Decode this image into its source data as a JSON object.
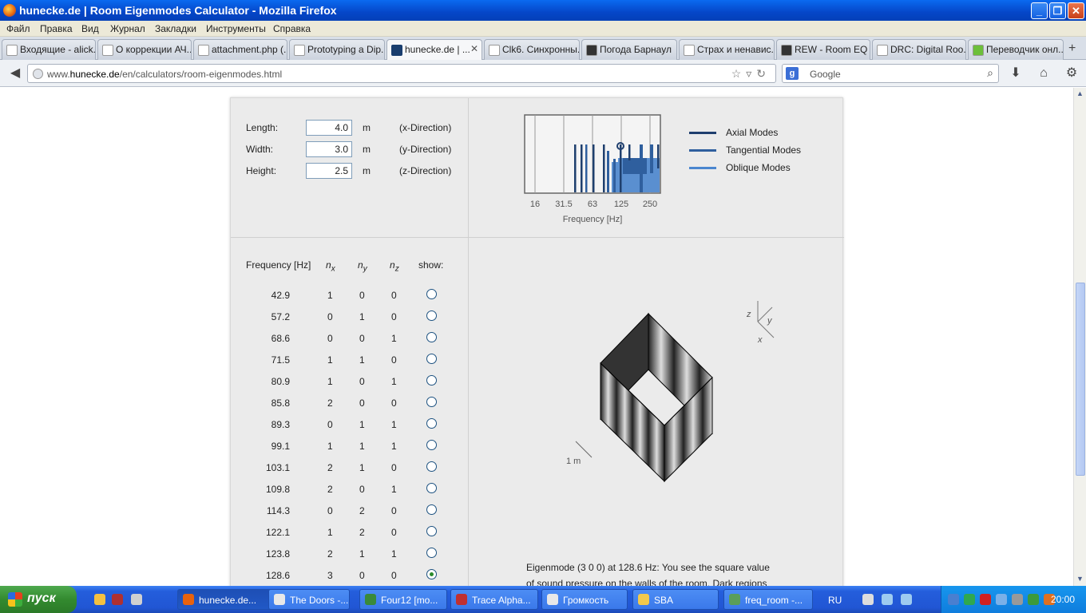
{
  "window": {
    "title": "hunecke.de | Room Eigenmodes Calculator - Mozilla Firefox"
  },
  "menu": [
    "Файл",
    "Правка",
    "Вид",
    "Журнал",
    "Закладки",
    "Инструменты",
    "Справка"
  ],
  "tabs": [
    {
      "label": "Входящие - alick..."
    },
    {
      "label": "О коррекции АЧ..."
    },
    {
      "label": "attachment.php (..."
    },
    {
      "label": "Prototyping a Dip..."
    },
    {
      "label": "hunecke.de | ...",
      "active": true
    },
    {
      "label": "Clk6. Синхронны..."
    },
    {
      "label": "Погода Барнаул"
    },
    {
      "label": "Страх и ненавис..."
    },
    {
      "label": "REW - Room EQ ..."
    },
    {
      "label": "DRC: Digital Roo..."
    },
    {
      "label": "Переводчик онл..."
    }
  ],
  "url": {
    "prefix": "www.",
    "domain": "hunecke.de",
    "path": "/en/calculators/room-eigenmodes.html"
  },
  "search": {
    "placeholder": "Google"
  },
  "dimensions": [
    {
      "label": "Length:",
      "value": "4.0",
      "unit": "m",
      "dir": "(x-Direction)"
    },
    {
      "label": "Width:",
      "value": "3.0",
      "unit": "m",
      "dir": "(y-Direction)"
    },
    {
      "label": "Height:",
      "value": "2.5",
      "unit": "m",
      "dir": "(z-Direction)"
    }
  ],
  "chart_data": {
    "type": "bar",
    "xlabel": "Frequency [Hz]",
    "xticks": [
      "16",
      "31.5",
      "63",
      "125",
      "250"
    ],
    "legend": [
      {
        "name": "Axial Modes",
        "color": "#1f3f6e"
      },
      {
        "name": "Tangential Modes",
        "color": "#2f5f9e"
      },
      {
        "name": "Oblique Modes",
        "color": "#4a86cf"
      }
    ]
  },
  "table": {
    "headers": {
      "freq": "Frequency [Hz]",
      "nx": "n",
      "nx_sub": "x",
      "ny": "n",
      "ny_sub": "y",
      "nz": "n",
      "nz_sub": "z",
      "show": "show:"
    },
    "rows": [
      [
        "42.9",
        "1",
        "0",
        "0"
      ],
      [
        "57.2",
        "0",
        "1",
        "0"
      ],
      [
        "68.6",
        "0",
        "0",
        "1"
      ],
      [
        "71.5",
        "1",
        "1",
        "0"
      ],
      [
        "80.9",
        "1",
        "0",
        "1"
      ],
      [
        "85.8",
        "2",
        "0",
        "0"
      ],
      [
        "89.3",
        "0",
        "1",
        "1"
      ],
      [
        "99.1",
        "1",
        "1",
        "1"
      ],
      [
        "103.1",
        "2",
        "1",
        "0"
      ],
      [
        "109.8",
        "2",
        "0",
        "1"
      ],
      [
        "114.3",
        "0",
        "2",
        "0"
      ],
      [
        "122.1",
        "1",
        "2",
        "0"
      ],
      [
        "123.8",
        "2",
        "1",
        "1"
      ],
      [
        "128.6",
        "3",
        "0",
        "0"
      ]
    ],
    "selected_index": 13
  },
  "viz": {
    "axis_z": "z",
    "axis_y": "y",
    "axis_x": "x",
    "scale": "1 m"
  },
  "description": {
    "line1": "Eigenmode (3 0 0) at 128.6 Hz: You see the square value",
    "line2": "of sound pressure on the walls of the room. Dark regions"
  },
  "taskbar": {
    "start": "пуск",
    "items": [
      "hunecke.de...",
      "The Doors -...",
      "Four12 [mo...",
      "Trace Alpha...",
      "Громкость",
      "SBA",
      "freq_room -..."
    ],
    "lang": "RU",
    "clock": "20:00"
  }
}
